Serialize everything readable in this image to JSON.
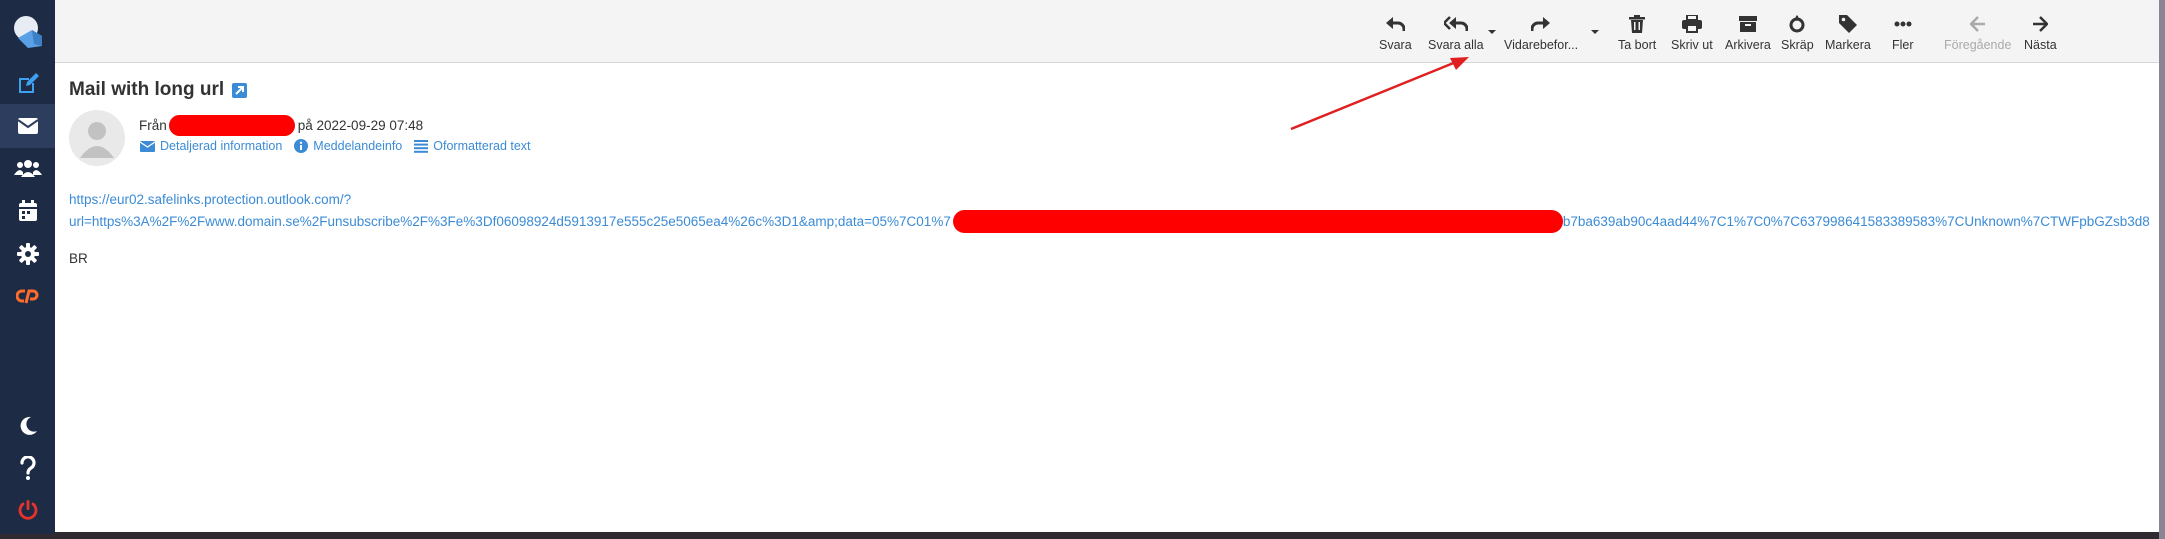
{
  "toolbar": {
    "reply": "Svara",
    "reply_all": "Svara alla",
    "forward": "Vidarebefor...",
    "delete": "Ta bort",
    "print": "Skriv ut",
    "archive": "Arkivera",
    "junk": "Skräp",
    "mark": "Markera",
    "more": "Fler",
    "previous": "Föregående",
    "next": "Nästa"
  },
  "message": {
    "subject": "Mail with long url",
    "from_prefix": "Från",
    "date_text": "på 2022-09-29 07:48",
    "links": {
      "details": "Detaljerad information",
      "message_info": "Meddelandeinfo",
      "plain_text": "Oformatterad text"
    },
    "url_line1": "https://eur02.safelinks.protection.outlook.com/?",
    "url_line2_start": "url=https%3A%2F%2Fwww.domain.se%2Funsubscribe%2F%3Fe%3Df06098924d5913917e555c25e5065ea4%26c%3D1&amp;data=05%7C01%7",
    "url_line2_end": "b7ba639ab90c4aad44%7C1%7C0%7C637998641583389583%7CUnknown%7CTWFpbGZsb3d8",
    "body_text": "BR"
  },
  "colors": {
    "sidebar": "#1e2b45",
    "accent": "#3b8bd6",
    "redaction": "#ff0000",
    "annotation_arrow": "#e02020"
  }
}
